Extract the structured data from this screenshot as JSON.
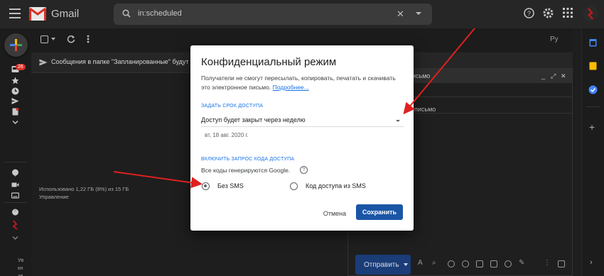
{
  "header": {
    "app_name": "Gmail",
    "search_value": "in:scheduled",
    "icons": [
      "menu-icon",
      "gmail-logo",
      "search-icon",
      "clear-icon",
      "help-icon",
      "settings-icon",
      "apps-icon",
      "avatar"
    ]
  },
  "rail": {
    "inbox_badge": "26",
    "icons": [
      "compose-icon",
      "inbox-icon",
      "star-icon",
      "clock-icon",
      "send-icon",
      "doc-icon",
      "more-icon",
      "chat-icon",
      "video-icon",
      "keyboard-icon",
      "hangouts-icon"
    ]
  },
  "toolbar": {
    "language": "Рy"
  },
  "folder_notice": "Сообщения в папке \"Запланированные\" будут",
  "storage": {
    "usage": "Использовано 1,22 ГБ (8%) из 15 ГБ",
    "manage": "Управление"
  },
  "left_truncated": [
    "Ув",
    "кн",
    "зв"
  ],
  "compose": {
    "title": "письмо",
    "body_fragment": "письмо",
    "send_label": "Отправить"
  },
  "dialog": {
    "title": "Конфиденциальный режим",
    "description": "Получатели не смогут пересылать, копировать, печатать и скачивать это электронное письмо.",
    "more_link": "Подробнее...",
    "expiry_section": "ЗАДАТЬ СРОК ДОСТУПА",
    "expiry_value": "Доступ будет закрыт через неделю",
    "expiry_date": "вт, 18 авг. 2020 г.",
    "passcode_section": "ВКЛЮЧИТЬ ЗАПРОС КОДА ДОСТУПА",
    "passcode_note": "Все коды генерируются Google.",
    "option_no_sms": "Без SMS",
    "option_sms": "Код доступа из SMS",
    "selected_option": "Без SMS",
    "cancel_label": "Отмена",
    "save_label": "Сохранить"
  },
  "colors": {
    "accent": "#1a56a6",
    "link": "#1a73e8",
    "annotation_arrow": "#e02020"
  }
}
